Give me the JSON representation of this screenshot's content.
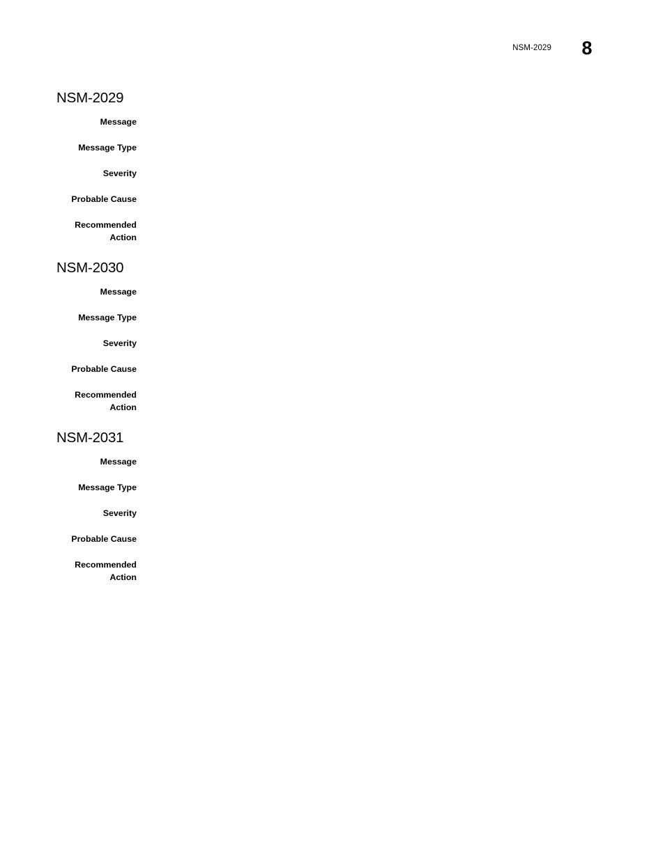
{
  "header": {
    "chapter_label": "NSM-2029",
    "page_number": "8"
  },
  "document": {
    "text_color": "#000000",
    "background_color": "#ffffff"
  },
  "sections": [
    {
      "title": "NSM-2029",
      "fields": [
        {
          "label": "Message",
          "value": ""
        },
        {
          "label": "Message Type",
          "value": ""
        },
        {
          "label": "Severity",
          "value": ""
        },
        {
          "label": "Probable Cause",
          "value": ""
        },
        {
          "label": "Recommended\nAction",
          "value": ""
        }
      ]
    },
    {
      "title": "NSM-2030",
      "fields": [
        {
          "label": "Message",
          "value": ""
        },
        {
          "label": "Message Type",
          "value": ""
        },
        {
          "label": "Severity",
          "value": ""
        },
        {
          "label": "Probable Cause",
          "value": ""
        },
        {
          "label": "Recommended\nAction",
          "value": ""
        }
      ]
    },
    {
      "title": "NSM-2031",
      "fields": [
        {
          "label": "Message",
          "value": ""
        },
        {
          "label": "Message Type",
          "value": ""
        },
        {
          "label": "Severity",
          "value": ""
        },
        {
          "label": "Probable Cause",
          "value": ""
        },
        {
          "label": "Recommended\nAction",
          "value": ""
        }
      ]
    }
  ]
}
